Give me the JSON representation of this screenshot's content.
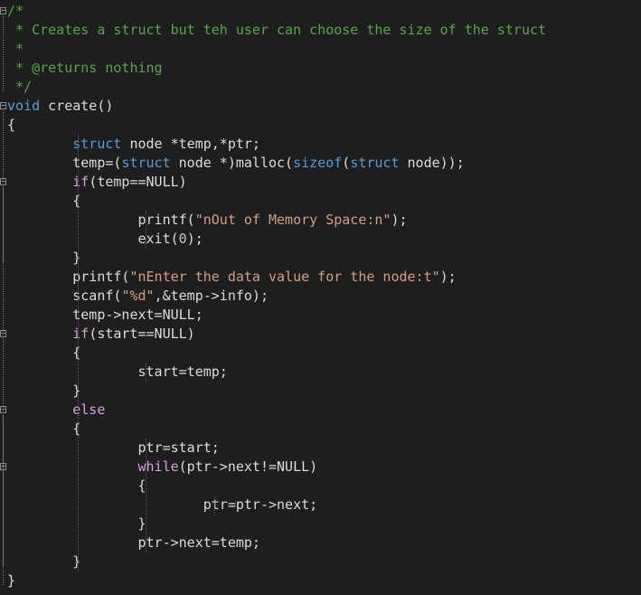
{
  "editor": {
    "language": "C",
    "colors": {
      "background": "#1e1e1e",
      "text": "#dcdcdc",
      "comment": "#57a64a",
      "keyword": "#569cd6",
      "control_keyword": "#d8a0df",
      "string": "#d69d85",
      "number": "#b5cea8"
    },
    "lines": [
      [
        {
          "t": "/*",
          "k": "comment"
        }
      ],
      [
        {
          "t": " * Creates a struct but teh user can choose the size of the struct",
          "k": "comment"
        }
      ],
      [
        {
          "t": " *",
          "k": "comment"
        }
      ],
      [
        {
          "t": " * @returns nothing",
          "k": "comment"
        }
      ],
      [
        {
          "t": " */",
          "k": "comment"
        }
      ],
      [
        {
          "t": "void",
          "k": "kw"
        },
        {
          "t": " create()",
          "k": "plain"
        }
      ],
      [
        {
          "t": "{",
          "k": "plain"
        }
      ],
      [
        {
          "t": "        ",
          "k": "plain"
        },
        {
          "t": "struct",
          "k": "kw"
        },
        {
          "t": " node *temp,*ptr;",
          "k": "plain"
        }
      ],
      [
        {
          "t": "        temp=(",
          "k": "plain"
        },
        {
          "t": "struct",
          "k": "kw"
        },
        {
          "t": " node *)malloc(",
          "k": "plain"
        },
        {
          "t": "sizeof",
          "k": "kw"
        },
        {
          "t": "(",
          "k": "plain"
        },
        {
          "t": "struct",
          "k": "kw"
        },
        {
          "t": " node));",
          "k": "plain"
        }
      ],
      [
        {
          "t": "        ",
          "k": "plain"
        },
        {
          "t": "if",
          "k": "flow"
        },
        {
          "t": "(temp==NULL)",
          "k": "plain"
        }
      ],
      [
        {
          "t": "        {",
          "k": "plain"
        }
      ],
      [
        {
          "t": "                printf(",
          "k": "plain"
        },
        {
          "t": "\"nOut of Memory Space:n\"",
          "k": "str"
        },
        {
          "t": ");",
          "k": "plain"
        }
      ],
      [
        {
          "t": "                exit(",
          "k": "plain"
        },
        {
          "t": "0",
          "k": "num"
        },
        {
          "t": ");",
          "k": "plain"
        }
      ],
      [
        {
          "t": "        }",
          "k": "plain"
        }
      ],
      [
        {
          "t": "        printf(",
          "k": "plain"
        },
        {
          "t": "\"nEnter the data value for the node:t\"",
          "k": "str"
        },
        {
          "t": ");",
          "k": "plain"
        }
      ],
      [
        {
          "t": "        scanf(",
          "k": "plain"
        },
        {
          "t": "\"%d\"",
          "k": "str"
        },
        {
          "t": ",&temp->info);",
          "k": "plain"
        }
      ],
      [
        {
          "t": "        temp->next=NULL;",
          "k": "plain"
        }
      ],
      [
        {
          "t": "        ",
          "k": "plain"
        },
        {
          "t": "if",
          "k": "flow"
        },
        {
          "t": "(start==NULL)",
          "k": "plain"
        }
      ],
      [
        {
          "t": "        {",
          "k": "plain"
        }
      ],
      [
        {
          "t": "                start=temp;",
          "k": "plain"
        }
      ],
      [
        {
          "t": "        }",
          "k": "plain"
        }
      ],
      [
        {
          "t": "        ",
          "k": "plain"
        },
        {
          "t": "else",
          "k": "flow"
        }
      ],
      [
        {
          "t": "        {",
          "k": "plain"
        }
      ],
      [
        {
          "t": "                ptr=start;",
          "k": "plain"
        }
      ],
      [
        {
          "t": "                ",
          "k": "plain"
        },
        {
          "t": "while",
          "k": "flow"
        },
        {
          "t": "(ptr->next!=NULL)",
          "k": "plain"
        }
      ],
      [
        {
          "t": "                {",
          "k": "plain"
        }
      ],
      [
        {
          "t": "                        ptr=ptr->next;",
          "k": "plain"
        }
      ],
      [
        {
          "t": "                }",
          "k": "plain"
        }
      ],
      [
        {
          "t": "                ptr->next=temp;",
          "k": "plain"
        }
      ],
      [
        {
          "t": "        }",
          "k": "plain"
        }
      ],
      [
        {
          "t": "}",
          "k": "plain"
        }
      ]
    ],
    "fold_lines": [
      0,
      5,
      9,
      17,
      21,
      24
    ]
  }
}
